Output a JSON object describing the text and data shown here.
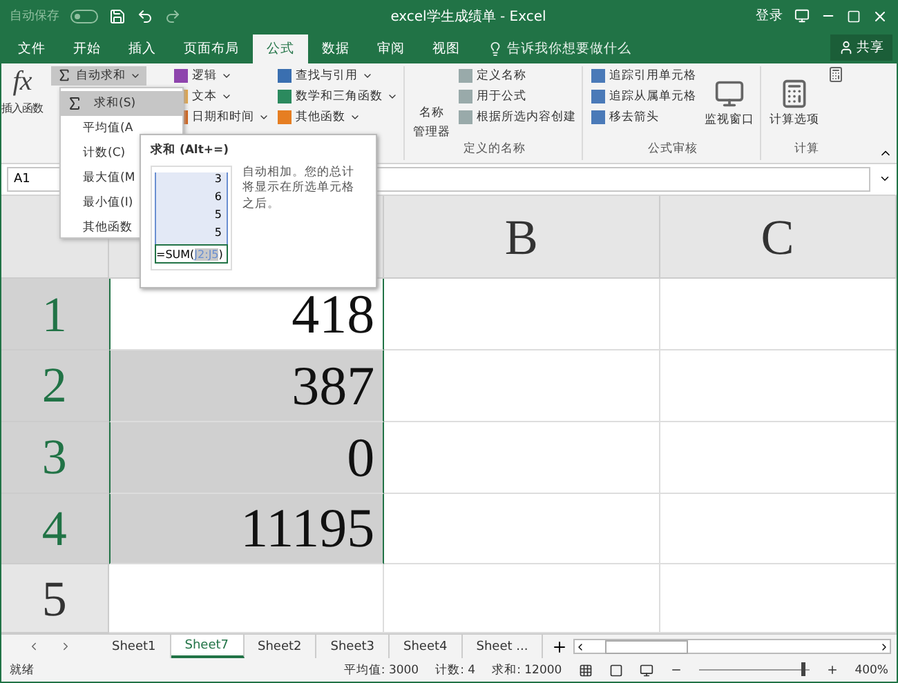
{
  "title_bar": {
    "autosave_label": "自动保存",
    "autosave_on": false,
    "title": "excel学生成绩单  -  Excel",
    "login": "登录"
  },
  "tabs": [
    {
      "label": "文件",
      "selected": false
    },
    {
      "label": "开始",
      "selected": false
    },
    {
      "label": "插入",
      "selected": false
    },
    {
      "label": "页面布局",
      "selected": false
    },
    {
      "label": "公式",
      "selected": true
    },
    {
      "label": "数据",
      "selected": false
    },
    {
      "label": "审阅",
      "selected": false
    },
    {
      "label": "视图",
      "selected": false
    }
  ],
  "tell_me": "告诉我你想要做什么",
  "share": "共享",
  "ribbon": {
    "insert_function": {
      "glyph": "fx",
      "label": "插入函数"
    },
    "library_col1": [
      "自动求和"
    ],
    "library_col2": [
      "逻辑",
      "文本",
      "日期和时间"
    ],
    "library_col3": [
      "查找与引用",
      "数学和三角函数",
      "其他函数"
    ],
    "name_manager": [
      "名称",
      "管理器"
    ],
    "defined_names": [
      "定义名称",
      "用于公式",
      "根据所选内容创建"
    ],
    "defined_names_label": "定义的名称",
    "auditing": [
      "追踪引用单元格",
      "追踪从属单元格",
      "移去箭头"
    ],
    "auditing_label": "公式审核",
    "watch": "监视窗口",
    "calc_options": "计算选项",
    "calc_label": "计算"
  },
  "name_box": "A1",
  "columns": [
    "B",
    "C"
  ],
  "rows": [
    {
      "header": "1",
      "value": "418",
      "selected": true,
      "active": true
    },
    {
      "header": "2",
      "value": "387",
      "selected": true,
      "active": false
    },
    {
      "header": "3",
      "value": "0",
      "selected": true,
      "active": false
    },
    {
      "header": "4",
      "value": "11195",
      "selected": true,
      "active": false
    },
    {
      "header": "5",
      "value": "",
      "selected": false,
      "active": false
    }
  ],
  "menu": [
    {
      "label": "求和(S)",
      "selected": true
    },
    {
      "label": "平均值(A",
      "selected": false
    },
    {
      "label": "计数(C)",
      "selected": false
    },
    {
      "label": "最大值(M",
      "selected": false
    },
    {
      "label": "最小值(I)",
      "selected": false
    },
    {
      "label": "其他函数",
      "selected": false
    }
  ],
  "tooltip": {
    "title": "求和 (Alt+=)",
    "samples": [
      "3",
      "6",
      "5",
      "5"
    ],
    "formula": "=SUM(",
    "ref": "J2:J5",
    "close": ")",
    "description": "自动相加。您的总计将显示在所选单元格之后。"
  },
  "sheets": [
    {
      "label": "Sheet1",
      "selected": false
    },
    {
      "label": "Sheet7",
      "selected": true
    },
    {
      "label": "Sheet2",
      "selected": false
    },
    {
      "label": "Sheet3",
      "selected": false
    },
    {
      "label": "Sheet4",
      "selected": false
    },
    {
      "label": "Sheet  ...",
      "selected": false
    }
  ],
  "status": {
    "ready": "就绪",
    "average": "平均值: 3000",
    "count": "计数: 4",
    "sum": "求和: 12000",
    "zoom": "400%",
    "zoom_slider": {
      "level": 0.95
    }
  }
}
